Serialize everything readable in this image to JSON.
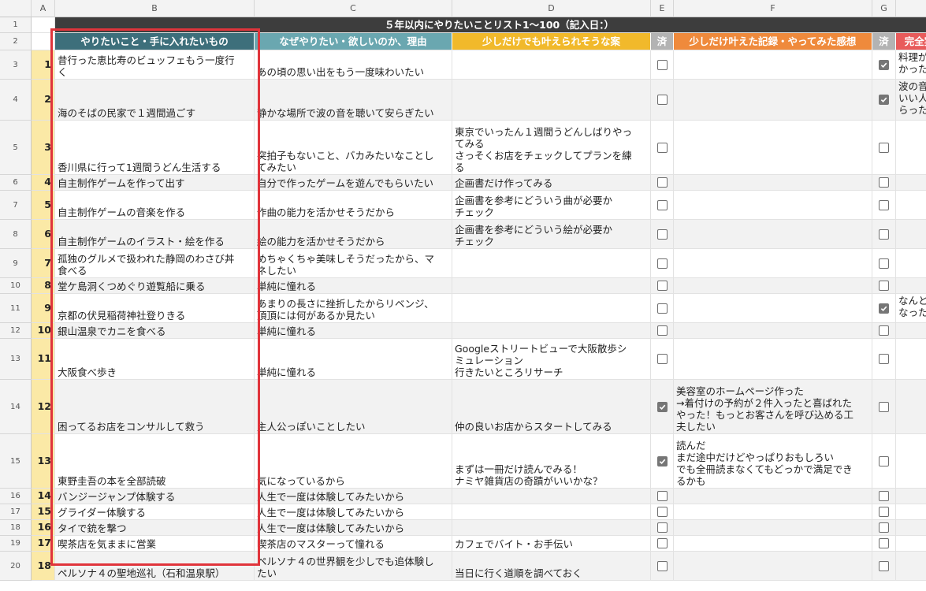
{
  "column_headers": [
    "A",
    "B",
    "C",
    "D",
    "E",
    "F",
    "G"
  ],
  "title": "５年以内にやりたいことリスト1〜100（記入日：）",
  "headers": {
    "b": "やりたいこと・手に入れたいもの",
    "c": "なぜやりたい・欲しいのか、理由",
    "d": "少しだけでも叶えられそうな案",
    "e": "済",
    "f": "少しだけ叶えた記録・やってみた感想",
    "g": "済",
    "h": "完全実"
  },
  "header_colors": {
    "b": "#3d6f7b",
    "c": "#6aa7b0",
    "d": "#f1b92b",
    "e": "#b3b3b3",
    "f": "#ef8a3c",
    "g": "#b3b3b3",
    "h": "#e85b5b"
  },
  "rows": [
    {
      "row": "3",
      "num": "1",
      "b": "昔行った恵比寿のビュッフェもう一度行\nく",
      "c": "あの頃の思い出をもう一度味わいたい",
      "d": "",
      "e": false,
      "f": "",
      "g": true,
      "h": "料理が\nかった"
    },
    {
      "row": "4",
      "num": "2",
      "b": "海のそばの民家で１週間過ごす",
      "c": "静かな場所で波の音を聴いて安らぎたい",
      "d": "",
      "e": false,
      "f": "",
      "g": true,
      "h": "波の音\nいい人\nらった"
    },
    {
      "row": "5",
      "num": "3",
      "b": "香川県に行って1週間うどん生活する",
      "c": "突拍子もないこと、バカみたいなことし\nてみたい",
      "d": "東京でいったん１週間うどんしばりやっ\nてみる\nさっそくお店をチェックしてプランを練\nる",
      "e": false,
      "f": "",
      "g": false,
      "h": ""
    },
    {
      "row": "6",
      "num": "4",
      "b": "自主制作ゲームを作って出す",
      "c": "自分で作ったゲームを遊んでもらいたい",
      "d": "企画書だけ作ってみる",
      "e": false,
      "f": "",
      "g": false,
      "h": ""
    },
    {
      "row": "7",
      "num": "5",
      "b": "自主制作ゲームの音楽を作る",
      "c": "作曲の能力を活かせそうだから",
      "d": "企画書を参考にどういう曲が必要か\nチェック",
      "e": false,
      "f": "",
      "g": false,
      "h": ""
    },
    {
      "row": "8",
      "num": "6",
      "b": "自主制作ゲームのイラスト・絵を作る",
      "c": "絵の能力を活かせそうだから",
      "d": "企画書を参考にどういう絵が必要か\nチェック",
      "e": false,
      "f": "",
      "g": false,
      "h": ""
    },
    {
      "row": "9",
      "num": "7",
      "b": "孤独のグルメで扱われた静岡のわさび丼\n食べる",
      "c": "めちゃくちゃ美味しそうだったから、マ\nネしたい",
      "d": "",
      "e": false,
      "f": "",
      "g": false,
      "h": ""
    },
    {
      "row": "10",
      "num": "8",
      "b": "堂ケ島洞くつめぐり遊覧船に乗る",
      "c": "単純に憧れる",
      "d": "",
      "e": false,
      "f": "",
      "g": false,
      "h": ""
    },
    {
      "row": "11",
      "num": "9",
      "b": "京都の伏見稲荷神社登りきる",
      "c": "あまりの長さに挫折したからリベンジ、\n頂頂には何があるか見たい",
      "d": "",
      "e": false,
      "f": "",
      "g": true,
      "h": "なんと\nなった"
    },
    {
      "row": "12",
      "num": "10",
      "b": "銀山温泉でカニを食べる",
      "c": "単純に憧れる",
      "d": "",
      "e": false,
      "f": "",
      "g": false,
      "h": ""
    },
    {
      "row": "13",
      "num": "11",
      "b": "大阪食べ歩き",
      "c": "単純に憧れる",
      "d": "Googleストリートビューで大阪散歩シ\nミュレーション\n行きたいところリサーチ",
      "e": false,
      "f": "",
      "g": false,
      "h": ""
    },
    {
      "row": "14",
      "num": "12",
      "b": "困ってるお店をコンサルして救う",
      "c": "主人公っぽいことしたい",
      "d": "仲の良いお店からスタートしてみる",
      "e": true,
      "f": "美容室のホームページ作った\n→着付けの予約が２件入ったと喜ばれた\nやった！もっとお客さんを呼び込める工\n夫したい",
      "g": false,
      "h": ""
    },
    {
      "row": "15",
      "num": "13",
      "b": "東野圭吾の本を全部読破",
      "c": "気になっているから",
      "d": "まずは一冊だけ読んでみる！\nナミヤ雑貨店の奇蹟がいいかな？",
      "e": true,
      "f": "読んだ\nまだ途中だけどやっぱりおもしろい\nでも全冊読まなくてもどっかで満足でき\nるかも",
      "g": false,
      "h": ""
    },
    {
      "row": "16",
      "num": "14",
      "b": "バンジージャンプ体験する",
      "c": "人生で一度は体験してみたいから",
      "d": "",
      "e": false,
      "f": "",
      "g": false,
      "h": ""
    },
    {
      "row": "17",
      "num": "15",
      "b": "グライダー体験する",
      "c": "人生で一度は体験してみたいから",
      "d": "",
      "e": false,
      "f": "",
      "g": false,
      "h": ""
    },
    {
      "row": "18",
      "num": "16",
      "b": "タイで銃を撃つ",
      "c": "人生で一度は体験してみたいから",
      "d": "",
      "e": false,
      "f": "",
      "g": false,
      "h": ""
    },
    {
      "row": "19",
      "num": "17",
      "b": "喫茶店を気ままに営業",
      "c": "喫茶店のマスターって憧れる",
      "d": "カフェでバイト・お手伝い",
      "e": false,
      "f": "",
      "g": false,
      "h": ""
    },
    {
      "row": "20",
      "num": "18",
      "b": "ペルソナ４の聖地巡礼（石和温泉駅）",
      "c": "ペルソナ４の世界観を少しでも追体験し\nたい",
      "d": "当日に行く道順を調べておく",
      "e": false,
      "f": "",
      "g": false,
      "h": ""
    }
  ]
}
